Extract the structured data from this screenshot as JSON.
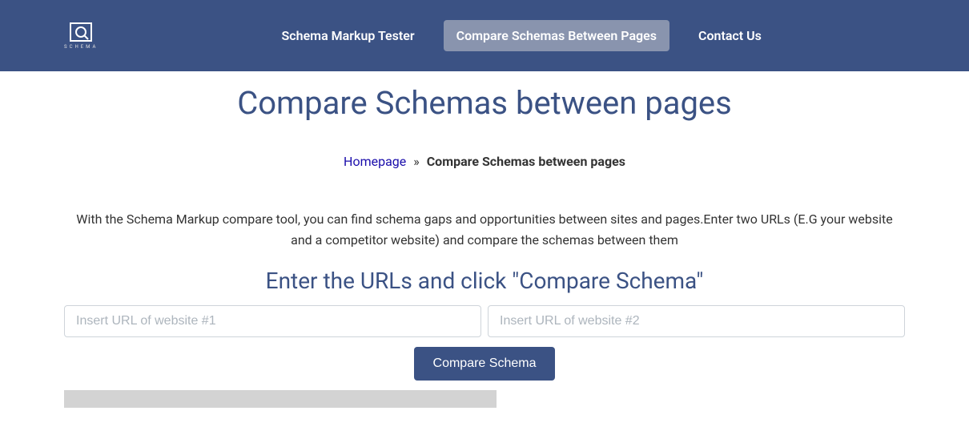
{
  "logo": {
    "text": "SCHEMA"
  },
  "nav": {
    "items": [
      {
        "label": "Schema Markup Tester",
        "active": false
      },
      {
        "label": "Compare Schemas Between Pages",
        "active": true
      },
      {
        "label": "Contact Us",
        "active": false
      }
    ]
  },
  "page": {
    "title": "Compare Schemas between pages"
  },
  "breadcrumb": {
    "home_label": "Homepage",
    "separator": "»",
    "current": "Compare Schemas between pages"
  },
  "description": "With the Schema Markup compare tool, you can find schema gaps and opportunities between sites and pages.Enter two URLs (E.G your website and a competitor website) and compare the schemas between them",
  "form": {
    "title": "Enter the URLs and click \"Compare Schema\"",
    "url1_placeholder": "Insert URL of website #1",
    "url2_placeholder": "Insert URL of website #2",
    "button_label": "Compare Schema"
  }
}
